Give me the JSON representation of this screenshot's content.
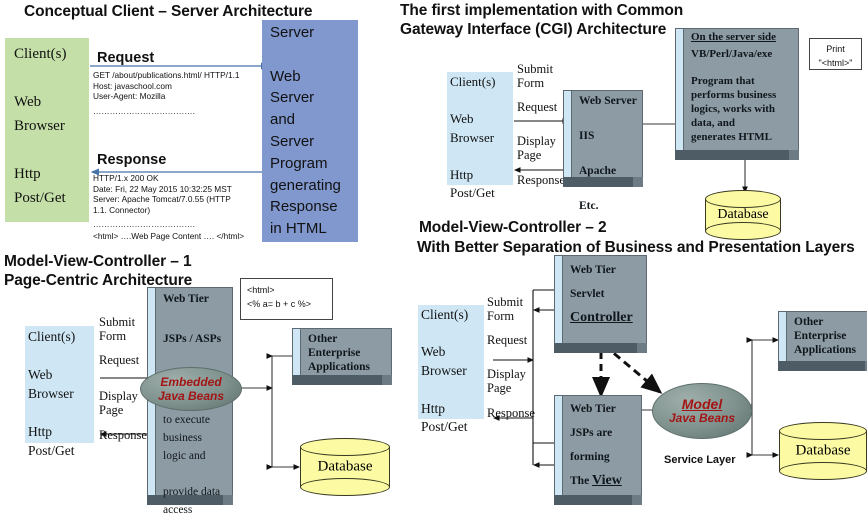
{
  "sections": {
    "conceptual": {
      "title": "Conceptual Client – Server Architecture",
      "client_box": "Client(s)\n\nWeb\nBrowser\n\nHttp\nPost/Get",
      "server_box": "Server\n\nWeb\nServer\nand\nServer\nProgram\ngenerating\nResponse\nin HTML",
      "request_label": "Request",
      "request_body": "GET /about/publications.html/ HTTP/1.1\nHost: javaschool.com\nUser-Agent: Mozilla",
      "request_dots": "……………………………….",
      "response_label": "Response",
      "response_body": "HTTP/1.x 200 OK\nDate: Fri, 22 May 2015 10:32:25 MST\nServer: Apache Tomcat/7.0.55 (HTTP\n1.1. Connector)",
      "response_dots": "……………………………….",
      "response_html": "<html> ….Web Page Content ….  </html>"
    },
    "cgi": {
      "title_line1": "The first implementation with Common",
      "title_line2": "Gateway Interface (CGI) Architecture",
      "client_box": "Client(s)\n\nWeb\nBrowser\n\nHttp\nPost/Get",
      "labels": {
        "submit_form": "Submit\nForm",
        "request": "Request",
        "display_page": "Display\nPage",
        "response": "Response"
      },
      "web_server_box": "Web Server\n\nIIS\n\nApache\n\nEtc.",
      "server_side_title": "On the server side",
      "server_side_body": "VB/Perl/Java/exe\n\nProgram that\nperforms business\nlogics, works with\ndata, and\ngenerates HTML",
      "print_box": "Print\n\"<html>\"",
      "database": "Database"
    },
    "mvc1": {
      "title_line1": "Model-View-Controller – 1",
      "title_line2": "Page-Centric Architecture",
      "client_box": "Client(s)\n\nWeb\nBrowser\n\nHttp\nPost/Get",
      "labels": {
        "submit_form": "Submit\nForm",
        "request": "Request",
        "display_page": "Display\nPage",
        "response": "Response"
      },
      "webtier_top": "Web Tier\n\nJSPs / ASPs\n\nwith",
      "ellipse_line1": "Embedded",
      "ellipse_line2": "Java Beans",
      "webtier_bottom": "to execute\nbusiness\nlogic and\n\nprovide data\naccess",
      "code_box": "<html>\n<% a= b + c %>",
      "other_apps": "Other\nEnterprise\nApplications",
      "database": "Database"
    },
    "mvc2": {
      "title_line1": "Model-View-Controller – 2",
      "title_line2": "With Better Separation of Business and Presentation Layers",
      "client_box": "Client(s)\n\nWeb\nBrowser\n\nHttp\nPost/Get",
      "labels": {
        "submit_form": "Submit\nForm",
        "request": "Request",
        "display_page": "Display\nPage",
        "response": "Response"
      },
      "controller_box_l1": "Web Tier",
      "controller_box_l2": "Servlet",
      "controller_box_l3": "Controller",
      "view_box_l1": "Web Tier",
      "view_box_l2": "JSPs are",
      "view_box_l3": "forming",
      "view_box_l4_pre": "The ",
      "view_box_l4_em": "View",
      "model_line1": "Model",
      "model_line2": "Java Beans",
      "service_layer": "Service Layer",
      "other_apps": "Other\nEnterprise\nApplications",
      "database": "Database"
    }
  },
  "colors": {
    "green_panel": "#c5dfa8",
    "blue_panel": "#8098ce",
    "light_blue": "#cfe7f5",
    "grey_box": "#8d9ba4",
    "db_yellow": "#fcfba4",
    "accent_red": "#a31515"
  }
}
